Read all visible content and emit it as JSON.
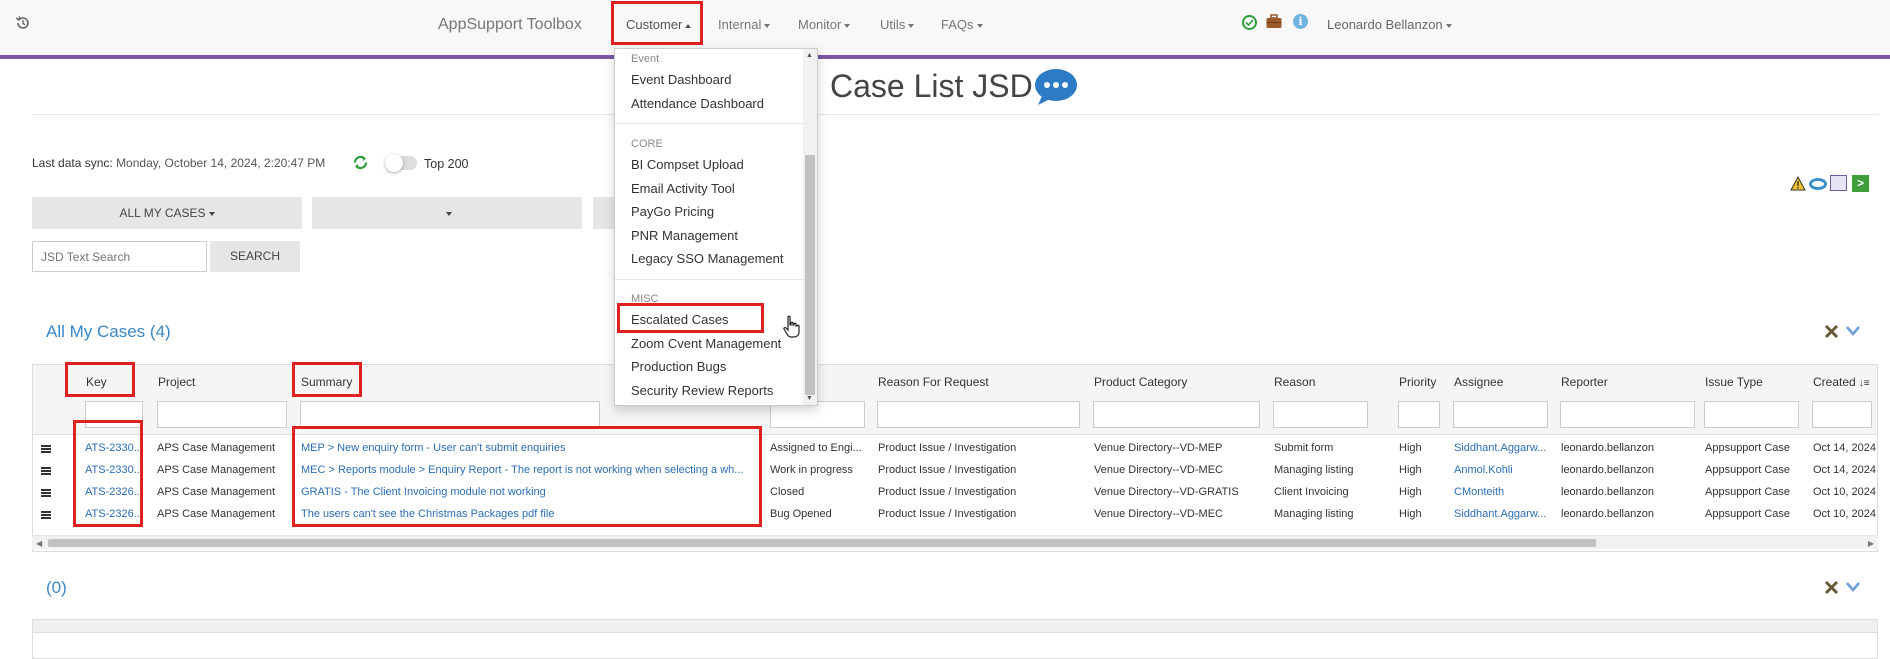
{
  "navbar": {
    "brand": "AppSupport Toolbox",
    "menus": [
      "Customer",
      "Internal",
      "Monitor",
      "Utils",
      "FAQs"
    ],
    "user": "Leonardo Bellanzon"
  },
  "dropdown": {
    "sections": [
      {
        "header": "Event",
        "items": [
          "Event Dashboard",
          "Attendance Dashboard"
        ]
      },
      {
        "header": "CORE",
        "items": [
          "BI Compset Upload",
          "Email Activity Tool",
          "PayGo Pricing",
          "PNR Management",
          "Legacy SSO Management"
        ]
      },
      {
        "header": "MISC",
        "items": [
          "Escalated Cases",
          "Zoom Cvent Management",
          "Production Bugs",
          "Security Review Reports"
        ]
      }
    ]
  },
  "page": {
    "title": "Case List JSD",
    "sync_label": "Last data sync:",
    "sync_value": "Monday, October 14, 2024, 2:20:47 PM",
    "top_label": "Top 200",
    "filter_all": "ALL MY CASES",
    "search_placeholder": "JSD Text Search",
    "search_button": "SEARCH"
  },
  "panels": {
    "first_title": "All My Cases (4)",
    "second_title": "(0)"
  },
  "table": {
    "headers": [
      "Key",
      "Project",
      "Summary",
      "Reason For Request",
      "Product Category",
      "Reason",
      "Priority",
      "Assignee",
      "Reporter",
      "Issue Type",
      "Created"
    ],
    "rows": [
      {
        "key": "ATS-2330...",
        "project": "APS Case Management",
        "summary": "MEP > New enquiry form - User can't submit enquiries",
        "status": "Assigned to Engi...",
        "reason_request": "Product Issue / Investigation",
        "category": "Venue Directory--VD-MEP",
        "reason": "Submit form",
        "priority": "High",
        "assignee": "Siddhant.Aggarw...",
        "reporter": "leonardo.bellanzon",
        "issue_type": "Appsupport Case",
        "created": "Oct 14, 2024"
      },
      {
        "key": "ATS-2330...",
        "project": "APS Case Management",
        "summary": "MEC > Reports module > Enquiry Report - The report is not working when selecting a wh...",
        "status": "Work in progress",
        "reason_request": "Product Issue / Investigation",
        "category": "Venue Directory--VD-MEC",
        "reason": "Managing listing",
        "priority": "High",
        "assignee": "Anmol.Kohli",
        "reporter": "leonardo.bellanzon",
        "issue_type": "Appsupport Case",
        "created": "Oct 14, 2024"
      },
      {
        "key": "ATS-2326...",
        "project": "APS Case Management",
        "summary": "GRATIS - The Client Invoicing module not working",
        "status": "Closed",
        "reason_request": "Product Issue / Investigation",
        "category": "Venue Directory--VD-GRATIS",
        "reason": "Client Invoicing",
        "priority": "High",
        "assignee": "CMonteith",
        "reporter": "leonardo.bellanzon",
        "issue_type": "Appsupport Case",
        "created": "Oct 10, 2024"
      },
      {
        "key": "ATS-2326...",
        "project": "APS Case Management",
        "summary": "The users can't see the Christmas Packages pdf file",
        "status": "Bug Opened",
        "reason_request": "Product Issue / Investigation",
        "category": "Venue Directory--VD-MEC",
        "reason": "Managing listing",
        "priority": "High",
        "assignee": "Siddhant.Aggarw...",
        "reporter": "leonardo.bellanzon",
        "issue_type": "Appsupport Case",
        "created": "Oct 10, 2024"
      }
    ]
  },
  "colors": {
    "accent": "#7e57a6",
    "link": "#2c6eb5",
    "highlight": "#e02020"
  }
}
